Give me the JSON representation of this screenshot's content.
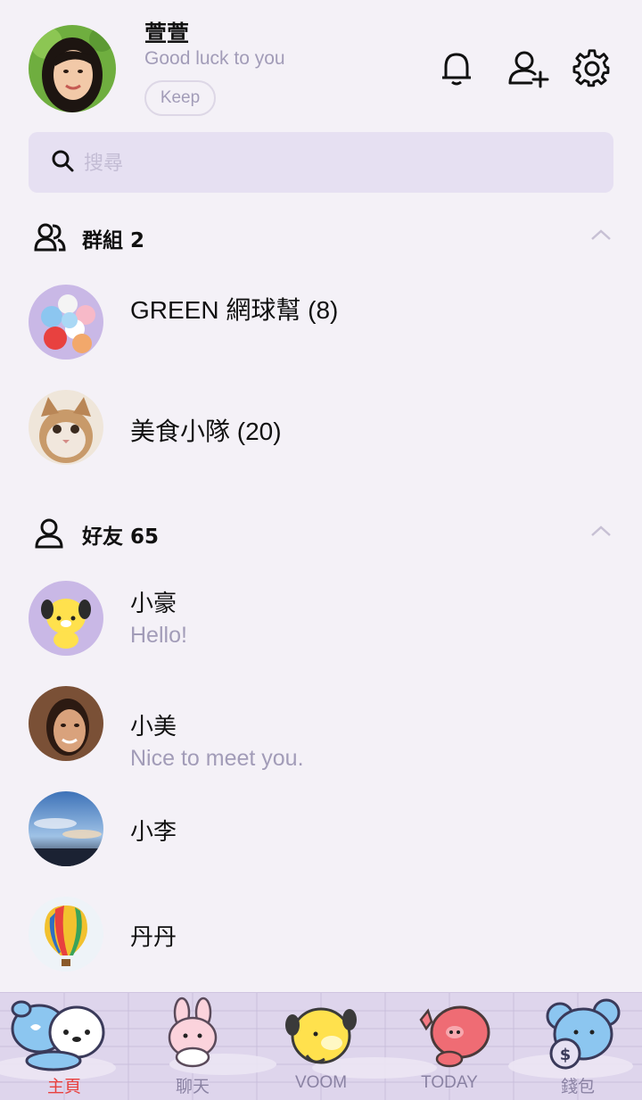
{
  "profile": {
    "name": "萱萱",
    "status": "Good luck to you",
    "keep_label": "Keep"
  },
  "search": {
    "placeholder": "搜尋",
    "value": ""
  },
  "groups": {
    "title": "群組 2",
    "items": [
      {
        "name": "GREEN 網球幫 (8)"
      },
      {
        "name": "美食小隊 (20)"
      }
    ]
  },
  "friends": {
    "title": "好友 65",
    "items": [
      {
        "name": "小豪",
        "message": "Hello!"
      },
      {
        "name": "小美",
        "message": "Nice to meet you."
      },
      {
        "name": "小李",
        "message": ""
      },
      {
        "name": "丹丹",
        "message": ""
      }
    ]
  },
  "tabs": [
    {
      "label": "主頁",
      "active": true
    },
    {
      "label": "聊天",
      "active": false
    },
    {
      "label": "VOOM",
      "active": false
    },
    {
      "label": "TODAY",
      "active": false
    },
    {
      "label": "錢包",
      "active": false
    }
  ],
  "icons": {
    "header": [
      "bell-icon",
      "add-friend-icon",
      "settings-icon"
    ],
    "search": "search-icon",
    "groups": "group-icon",
    "friends": "person-icon",
    "collapse": "chevron-up-icon"
  },
  "colors": {
    "background": "#f4f1f7",
    "search_bg": "#e6e0f2",
    "muted_text": "#a29cb8",
    "active_tab": "#e8413f",
    "tabbar_bg": "#ded5ec"
  }
}
